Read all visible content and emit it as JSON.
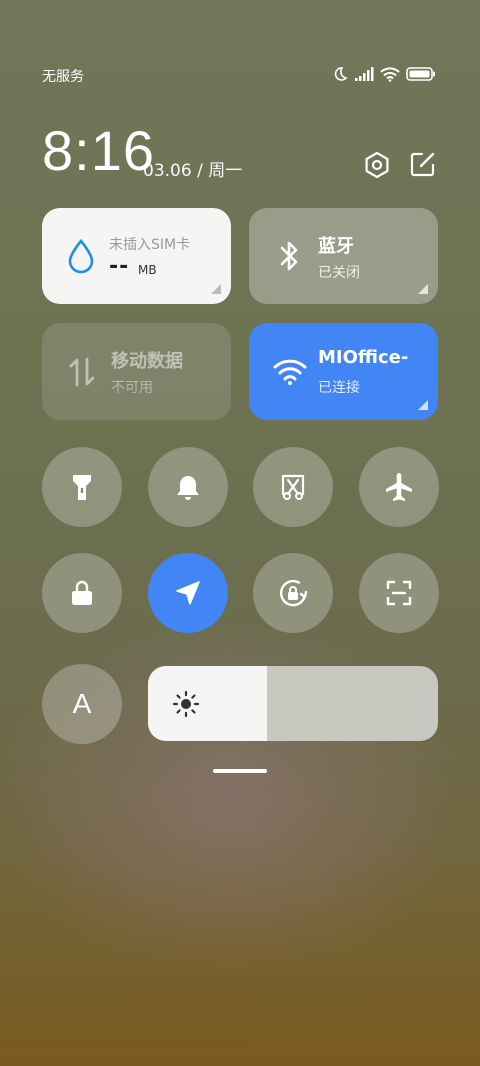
{
  "status_bar": {
    "carrier": "无服务",
    "icons": [
      "moon-icon",
      "signal-icon",
      "wifi-icon",
      "battery-icon"
    ]
  },
  "header": {
    "time": "8:16",
    "date": "03.06 / 周一"
  },
  "tiles": {
    "data_usage": {
      "label": "未插入SIM卡",
      "value": "--",
      "unit": "MB"
    },
    "bluetooth": {
      "title": "蓝牙",
      "status": "已关闭"
    },
    "mobile_data": {
      "title": "移动数据",
      "status": "不可用"
    },
    "wifi": {
      "title": "MIOffice-",
      "status": "已连接"
    }
  },
  "toggles": [
    {
      "icon": "flashlight-icon",
      "active": false
    },
    {
      "icon": "bell-icon",
      "active": false
    },
    {
      "icon": "screenshot-icon",
      "active": false
    },
    {
      "icon": "airplane-icon",
      "active": false
    },
    {
      "icon": "lock-icon",
      "active": false
    },
    {
      "icon": "location-icon",
      "active": true
    },
    {
      "icon": "rotation-lock-icon",
      "active": false
    },
    {
      "icon": "scan-icon",
      "active": false
    }
  ],
  "font_size_label": "A",
  "brightness": {
    "level_percent": 41
  },
  "colors": {
    "accent": "#4285f4",
    "tile_light": "#f5f5f3"
  }
}
